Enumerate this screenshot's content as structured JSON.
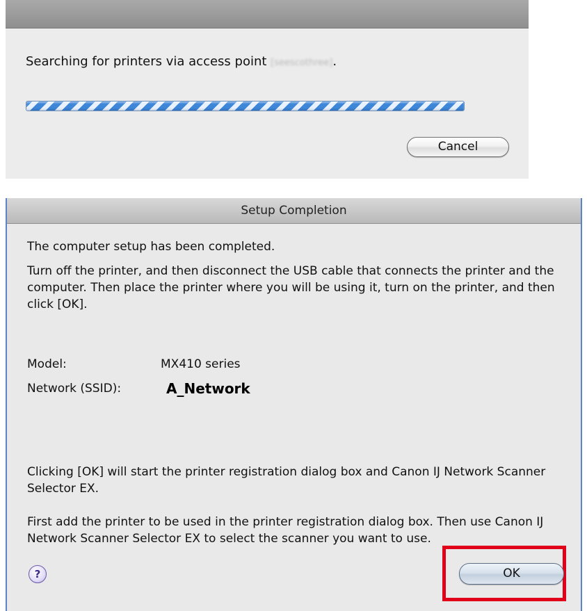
{
  "search_dialog": {
    "message_prefix": "Searching for printers via access point ",
    "access_point_name": "[seescothree]",
    "message_suffix": ".",
    "cancel_label": "Cancel"
  },
  "completion_dialog": {
    "title": "Setup Completion",
    "completed_text": "The computer setup has been completed.",
    "instruction_text": "Turn off the printer, and then disconnect the USB cable that connects the printer and the computer. Then place the printer where you will be using it, turn on the printer, and then click [OK].",
    "model_label": "Model:",
    "model_value": "MX410 series",
    "network_label": "Network (SSID):",
    "network_value": "A_Network",
    "info_text_1": "Clicking [OK] will start the printer registration dialog box and Canon IJ Network Scanner Selector EX.",
    "info_text_2": "First add the printer to be used in the printer registration dialog box. Then use Canon IJ Network Scanner Selector EX to select the scanner you want to use.",
    "help_label": "?",
    "ok_label": "OK"
  },
  "colors": {
    "highlight": "#e1001a",
    "progress_blue": "#3d86d8",
    "window_border": "#5b84c4"
  }
}
